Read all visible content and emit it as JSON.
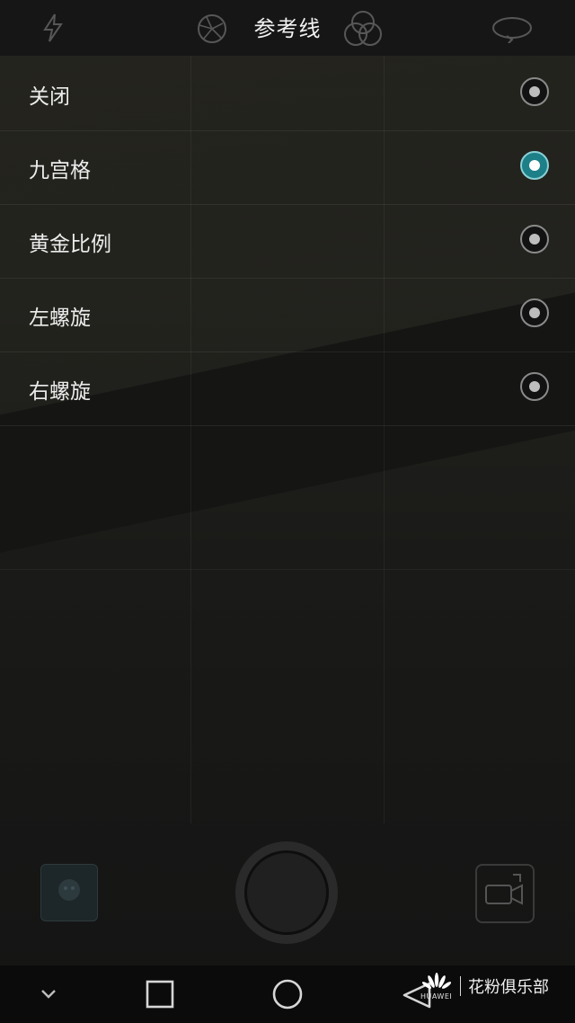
{
  "header": {
    "title": "参考线"
  },
  "top_icons": [
    "flash-icon",
    "aperture-icon",
    "filter-icon",
    "rotate-icon"
  ],
  "options": [
    {
      "label": "关闭",
      "selected": false
    },
    {
      "label": "九宫格",
      "selected": true
    },
    {
      "label": "黄金比例",
      "selected": false
    },
    {
      "label": "左螺旋",
      "selected": false
    },
    {
      "label": "右螺旋",
      "selected": false
    }
  ],
  "colors": {
    "accent": "#1d7f88",
    "background": "#141414"
  },
  "watermark": {
    "brand": "HUAWEI",
    "text": "花粉俱乐部"
  }
}
